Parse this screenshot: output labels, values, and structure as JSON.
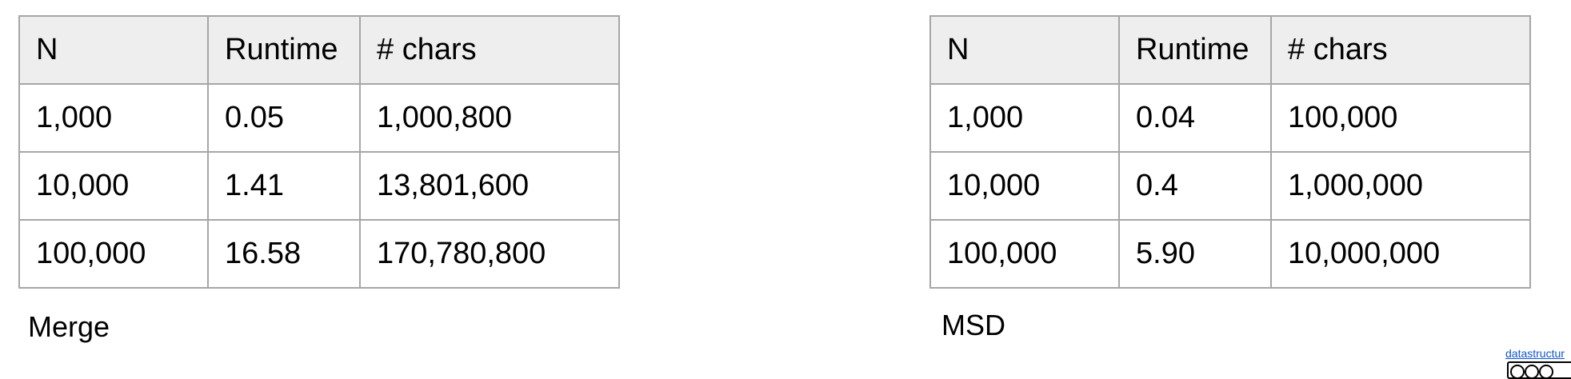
{
  "tables": {
    "merge": {
      "headers": [
        "N",
        "Runtime",
        "# chars"
      ],
      "rows": [
        [
          "1,000",
          "0.05",
          "1,000,800"
        ],
        [
          "10,000",
          "1.41",
          "13,801,600"
        ],
        [
          "100,000",
          "16.58",
          "170,780,800"
        ]
      ],
      "caption": "Merge"
    },
    "msd": {
      "headers": [
        "N",
        "Runtime",
        "# chars"
      ],
      "rows": [
        [
          "1,000",
          "0.04",
          "100,000"
        ],
        [
          "10,000",
          "0.4",
          "1,000,000"
        ],
        [
          "100,000",
          "5.90",
          "10,000,000"
        ]
      ],
      "caption": "MSD"
    }
  },
  "footer": {
    "credit_link": "datastructur",
    "license_icon": "creative-commons-badge-icon"
  },
  "colors": {
    "border": "#a6a6a6",
    "header_background": "#eeeeee",
    "link": "#1155cc"
  }
}
